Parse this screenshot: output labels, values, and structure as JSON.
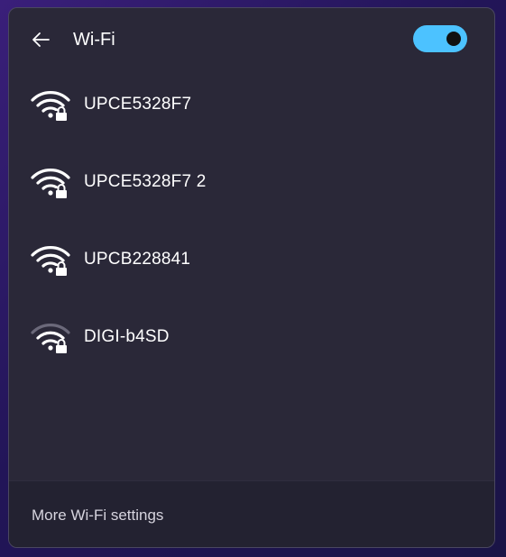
{
  "header": {
    "title": "Wi-Fi",
    "back_icon": "back-arrow-icon",
    "toggle_state": "on",
    "toggle_color": "#4cc2ff"
  },
  "networks": [
    {
      "name": "UPCE5328F7",
      "signal": "full",
      "secured": true
    },
    {
      "name": "UPCE5328F7 2",
      "signal": "full",
      "secured": true
    },
    {
      "name": "UPCB228841",
      "signal": "full",
      "secured": true
    },
    {
      "name": "DIGI-b4SD",
      "signal": "partial",
      "secured": true
    }
  ],
  "footer": {
    "link_label": "More Wi-Fi settings"
  }
}
